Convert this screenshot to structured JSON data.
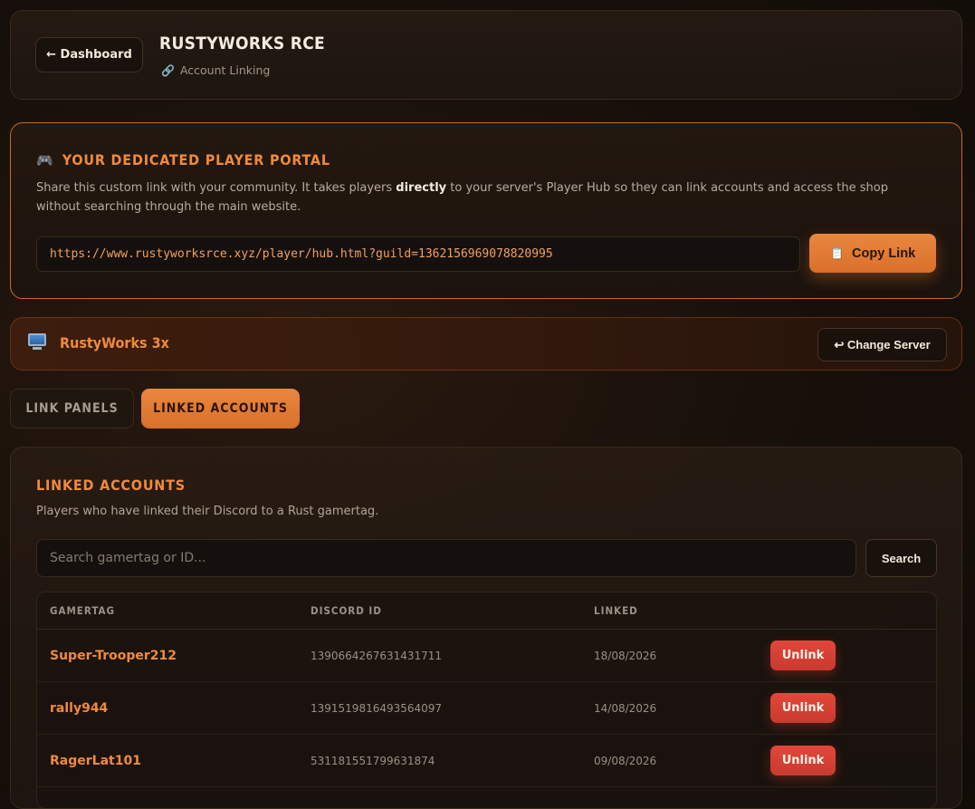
{
  "header": {
    "back_label": "← Dashboard",
    "title": "RUSTYWORKS RCE",
    "subtitle_icon": "link-icon",
    "subtitle": "Account Linking"
  },
  "portal": {
    "icon": "gamepad-icon",
    "title": "YOUR DEDICATED PLAYER PORTAL",
    "desc_before": "Share this custom link with your community. It takes players ",
    "desc_bold": "directly",
    "desc_after": " to your server's Player Hub so they can link accounts and access the shop without searching through the main website.",
    "link": "https://www.rustyworksrce.xyz/player/hub.html?guild=1362156969078820995",
    "copy_icon": "clipboard-icon",
    "copy_label": "Copy Link"
  },
  "server": {
    "icon": "monitor-icon",
    "name": "RustyWorks 3x",
    "change_label": "↩ Change Server"
  },
  "tabs": [
    {
      "label": "LINK PANELS",
      "active": false
    },
    {
      "label": "LINKED ACCOUNTS",
      "active": true
    }
  ],
  "accounts": {
    "title": "LINKED ACCOUNTS",
    "desc": "Players who have linked their Discord to a Rust gamertag.",
    "search_placeholder": "Search gamertag or ID...",
    "search_label": "Search",
    "columns": [
      "GAMERTAG",
      "DISCORD ID",
      "LINKED",
      ""
    ],
    "rows": [
      {
        "gamertag": "Super-Trooper212",
        "discord_id": "1390664267631431711",
        "linked": "18/08/2026",
        "action": "Unlink"
      },
      {
        "gamertag": "rally944",
        "discord_id": "1391519816493564097",
        "linked": "14/08/2026",
        "action": "Unlink"
      },
      {
        "gamertag": "RagerLat101",
        "discord_id": "531181551799631874",
        "linked": "09/08/2026",
        "action": "Unlink"
      }
    ]
  },
  "colors": {
    "accent": "#f08a3c",
    "danger": "#d8413a",
    "border_active": "#c8692c"
  }
}
